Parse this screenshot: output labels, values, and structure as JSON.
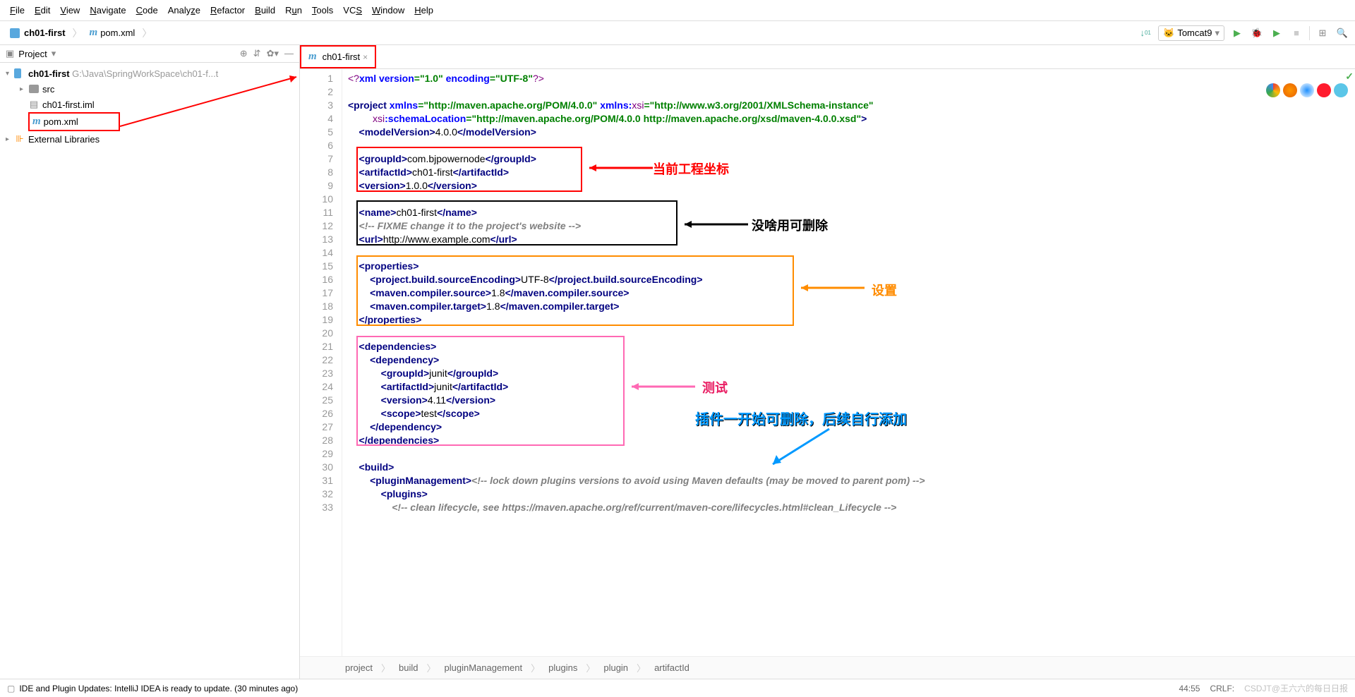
{
  "menu": {
    "file": "File",
    "edit": "Edit",
    "view": "View",
    "navigate": "Navigate",
    "code": "Code",
    "analyze": "Analyze",
    "refactor": "Refactor",
    "build": "Build",
    "run": "Run",
    "tools": "Tools",
    "vcs": "VCS",
    "window": "Window",
    "help": "Help"
  },
  "navbar": {
    "project": "ch01-first",
    "file": "pom.xml",
    "runConfig": "Tomcat9"
  },
  "panel": {
    "title": "Project"
  },
  "tree": {
    "root": "ch01-first",
    "rootPath": "G:\\Java\\SpringWorkSpace\\ch01-f...t",
    "src": "src",
    "iml": "ch01-first.iml",
    "pom": "pom.xml",
    "extlib": "External Libraries"
  },
  "tab": {
    "name": "ch01-first"
  },
  "lines": [
    "1",
    "2",
    "3",
    "4",
    "5",
    "6",
    "7",
    "8",
    "9",
    "10",
    "11",
    "12",
    "13",
    "14",
    "15",
    "16",
    "17",
    "18",
    "19",
    "20",
    "21",
    "22",
    "23",
    "24",
    "25",
    "26",
    "27",
    "28",
    "29",
    "30",
    "31",
    "32",
    "33"
  ],
  "code": {
    "l1a": "<?",
    "l1b": "xml version",
    "l1c": "=\"1.0\" ",
    "l1d": "encoding",
    "l1e": "=\"UTF-8\"",
    "l1f": "?>",
    "l3a": "<project ",
    "l3b": "xmlns",
    "l3c": "=\"http://maven.apache.org/POM/4.0.0\" ",
    "l3d": "xmlns:",
    "l3e": "xsi",
    "l3f": "=\"http://www.w3.org/2001/XMLSchema-instance\"",
    "l4a": "         ",
    "l4b": "xsi",
    "l4c": ":schemaLocation",
    "l4d": "=\"http://maven.apache.org/POM/4.0.0 http://maven.apache.org/xsd/maven-4.0.0.xsd\"",
    "l4e": ">",
    "l5a": "    <modelVersion>",
    "l5b": "4.0.0",
    "l5c": "</modelVersion>",
    "l7a": "    <groupId>",
    "l7b": "com.bjpowernode",
    "l7c": "</groupId>",
    "l8a": "    <artifactId>",
    "l8b": "ch01-first",
    "l8c": "</artifactId>",
    "l9a": "    <version>",
    "l9b": "1.0.0",
    "l9c": "</version>",
    "l11a": "    <name>",
    "l11b": "ch01-first",
    "l11c": "</name>",
    "l12a": "    <!-- FIXME change it to the project's website -->",
    "l13a": "    <url>",
    "l13b": "http://www.example.com",
    "l13c": "</url>",
    "l15a": "    <properties>",
    "l16a": "        <project.build.sourceEncoding>",
    "l16b": "UTF-8",
    "l16c": "</project.build.sourceEncoding>",
    "l17a": "        <maven.compiler.source>",
    "l17b": "1.8",
    "l17c": "</maven.compiler.source>",
    "l18a": "        <maven.compiler.target>",
    "l18b": "1.8",
    "l18c": "</maven.compiler.target>",
    "l19a": "    </properties>",
    "l21a": "    <dependencies>",
    "l22a": "        <dependency>",
    "l23a": "            <groupId>",
    "l23b": "junit",
    "l23c": "</groupId>",
    "l24a": "            <artifactId>",
    "l24b": "junit",
    "l24c": "</artifactId>",
    "l25a": "            <version>",
    "l25b": "4.11",
    "l25c": "</version>",
    "l26a": "            <scope>",
    "l26b": "test",
    "l26c": "</scope>",
    "l27a": "        </dependency>",
    "l28a": "    </dependencies>",
    "l30a": "    <build>",
    "l31a": "        <pluginManagement>",
    "l31b": "<!-- lock down plugins versions to avoid using Maven defaults (may be moved to parent pom) -->",
    "l32a": "            <plugins>",
    "l33a": "                <!-- clean lifecycle, see https://maven.apache.org/ref/current/maven-core/lifecycles.html#clean_Lifecycle -->"
  },
  "annotations": {
    "a1": "当前工程坐标",
    "a2": "没啥用可删除",
    "a3": "设置",
    "a4": "测试",
    "a5": "插件一开始可删除，后续自行添加"
  },
  "breadcrumb": {
    "b1": "project",
    "b2": "build",
    "b3": "pluginManagement",
    "b4": "plugins",
    "b5": "plugin",
    "b6": "artifactId"
  },
  "statusbar": {
    "msg": "IDE and Plugin Updates: IntelliJ IDEA is ready to update. (30 minutes ago)",
    "pos": "44:55",
    "enc": "CRLF:",
    "cs": "CSDJT@王六六的每日日报"
  }
}
